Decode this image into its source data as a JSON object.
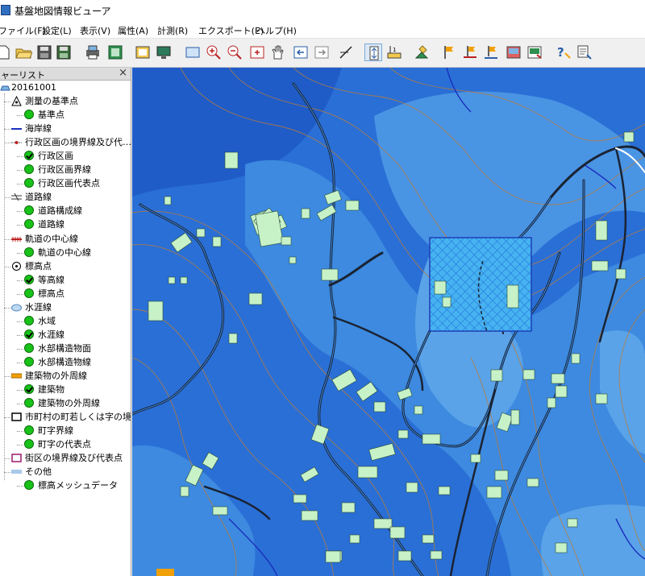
{
  "window": {
    "title": "基盤地図情報ビューア"
  },
  "menu": [
    "ファイル(F)",
    "設定(L)",
    "表示(V)",
    "属性(A)",
    "計測(R)",
    "エクスポート(E)",
    "ヘルプ(H)"
  ],
  "toolbar": [
    {
      "icon": "new-file-icon"
    },
    {
      "icon": "open-folder-icon"
    },
    {
      "icon": "save-icon"
    },
    {
      "icon": "save-as-icon"
    },
    {
      "icon": "print-icon"
    },
    {
      "icon": "layer-icon"
    },
    {
      "icon": "print-preview-icon"
    },
    {
      "icon": "monitor-icon"
    },
    {
      "icon": "select-rectangle-icon"
    },
    {
      "icon": "zoom-in-icon"
    },
    {
      "icon": "zoom-out-icon"
    },
    {
      "icon": "zoom-area-icon"
    },
    {
      "icon": "pan-hand-icon"
    },
    {
      "icon": "back-icon"
    },
    {
      "icon": "forward-icon"
    },
    {
      "icon": "slope-icon"
    },
    {
      "icon": "vertical-scale-icon"
    },
    {
      "icon": "height-measure-icon"
    },
    {
      "icon": "elevation-marker-icon"
    },
    {
      "icon": "flag-icon"
    },
    {
      "icon": "flag-base-icon"
    },
    {
      "icon": "flag-line-icon"
    },
    {
      "icon": "export-image-icon"
    },
    {
      "icon": "export-data-icon"
    },
    {
      "icon": "help-icon"
    },
    {
      "icon": "info-icon"
    }
  ],
  "layer_panel": {
    "title": "ャーリスト",
    "close_glyph": "×",
    "root": "20161001",
    "items": [
      {
        "label": "測量の基準点",
        "icon": "survey-point-icon",
        "level": 1
      },
      {
        "label": "基準点",
        "icon": "green-circle",
        "level": 2
      },
      {
        "label": "海岸線",
        "icon": "coastline-icon",
        "level": 1
      },
      {
        "label": "行政区画の境界線及び代…",
        "icon": "admin-boundary-icon",
        "level": 1
      },
      {
        "label": "行政区画",
        "icon": "green-check",
        "level": 2
      },
      {
        "label": "行政区画界線",
        "icon": "green-circle",
        "level": 2
      },
      {
        "label": "行政区画代表点",
        "icon": "green-circle",
        "level": 2
      },
      {
        "label": "道路線",
        "icon": "road-icon",
        "level": 1
      },
      {
        "label": "道路構成線",
        "icon": "green-circle",
        "level": 2
      },
      {
        "label": "道路線",
        "icon": "green-circle",
        "level": 2
      },
      {
        "label": "軌道の中心線",
        "icon": "railway-icon",
        "level": 1
      },
      {
        "label": "軌道の中心線",
        "icon": "green-circle",
        "level": 2
      },
      {
        "label": "標高点",
        "icon": "elevation-point-icon",
        "level": 1
      },
      {
        "label": "等高線",
        "icon": "green-check",
        "level": 2
      },
      {
        "label": "標高点",
        "icon": "green-circle",
        "level": 2
      },
      {
        "label": "水涯線",
        "icon": "waterline-icon",
        "level": 1
      },
      {
        "label": "水域",
        "icon": "green-circle",
        "level": 2
      },
      {
        "label": "水涯線",
        "icon": "green-check",
        "level": 2
      },
      {
        "label": "水部構造物面",
        "icon": "green-circle",
        "level": 2
      },
      {
        "label": "水部構造物線",
        "icon": "green-circle",
        "level": 2
      },
      {
        "label": "建築物の外周線",
        "icon": "building-outline-icon",
        "level": 1
      },
      {
        "label": "建築物",
        "icon": "green-check",
        "level": 2
      },
      {
        "label": "建築物の外周線",
        "icon": "green-circle",
        "level": 2
      },
      {
        "label": "市町村の町若しくは字の境…",
        "icon": "town-boundary-icon",
        "level": 1
      },
      {
        "label": "町字界線",
        "icon": "green-circle",
        "level": 2
      },
      {
        "label": "町字の代表点",
        "icon": "green-circle",
        "level": 2
      },
      {
        "label": "街区の境界線及び代表点",
        "icon": "block-boundary-icon",
        "level": 1
      },
      {
        "label": "その他",
        "icon": "other-icon",
        "level": 1
      },
      {
        "label": "標高メッシュデータ",
        "icon": "green-circle",
        "level": 2
      }
    ]
  },
  "map": {
    "colors": {
      "dem_dark": "#1f5cc8",
      "dem_mid": "#2a6fd6",
      "dem_light": "#3d8ae0",
      "dem_pale": "#5aa3e8",
      "contour": "#b77c3c",
      "road": "#1a2333",
      "building": "#c7f2c8",
      "water": "#1a2fbf"
    }
  }
}
